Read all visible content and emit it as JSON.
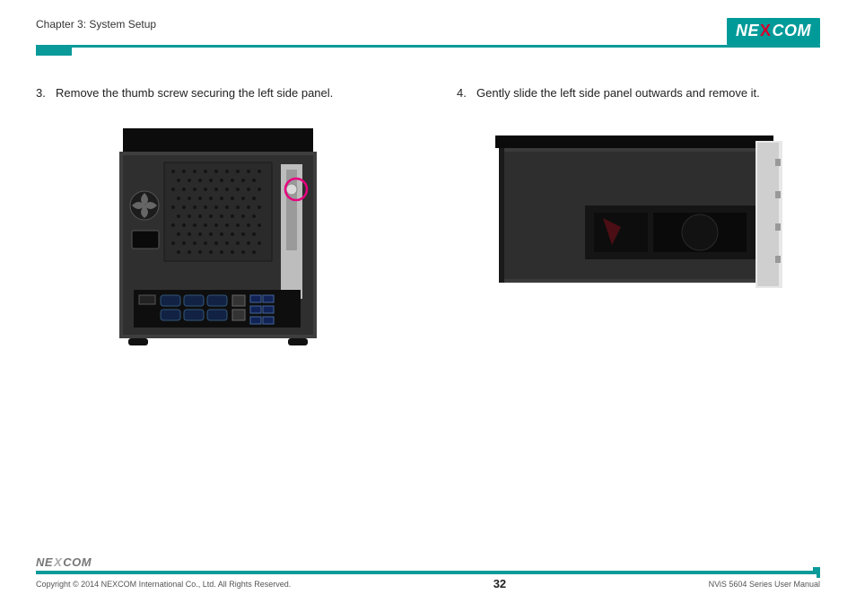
{
  "header": {
    "chapter": "Chapter 3: System Setup",
    "logo_parts": {
      "left": "NE",
      "x": "X",
      "right": "COM"
    }
  },
  "steps": [
    {
      "num": "3.",
      "text": "Remove the thumb screw securing the left side panel."
    },
    {
      "num": "4.",
      "text": "Gently slide the left side panel outwards and remove it."
    }
  ],
  "figures": {
    "left": {
      "alt": "rear view of device with thumb screw circled",
      "highlight_color": "#e6007e"
    },
    "right": {
      "alt": "side panel being slid outward"
    }
  },
  "footer": {
    "logo_parts": {
      "left": "NE",
      "x": "X",
      "right": "COM"
    },
    "copyright": "Copyright © 2014 NEXCOM International Co., Ltd. All Rights Reserved.",
    "page_number": "32",
    "manual": "NViS 5604 Series User Manual"
  }
}
